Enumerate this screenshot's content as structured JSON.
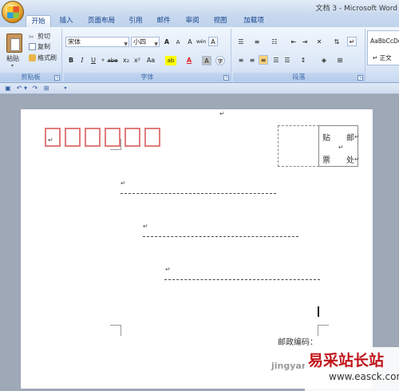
{
  "window": {
    "title": "文档 3 - Microsoft Word"
  },
  "tabs": [
    "开始",
    "插入",
    "页面布局",
    "引用",
    "邮件",
    "审阅",
    "视图",
    "加载项"
  ],
  "clipboard": {
    "paste": "粘贴",
    "cut": "剪切",
    "copy": "复制",
    "format_painter": "格式刷",
    "label": "剪贴板"
  },
  "font": {
    "name": "宋体",
    "size": "小四",
    "label": "字体",
    "buttons": {
      "grow": "A",
      "shrink": "A",
      "clear": "A",
      "phonetic": "wén",
      "border": "A",
      "bold": "B",
      "italic": "I",
      "underline": "U",
      "strike": "abe",
      "subscript": "x₂",
      "superscript": "x²",
      "case": "Aa",
      "highlight": "ab",
      "color": "A",
      "shade": "A",
      "circle": "字"
    }
  },
  "paragraph": {
    "label": "段落"
  },
  "styles": {
    "preview": "AaBbCcDd",
    "normal": "↵ 正文"
  },
  "colors": {
    "accent": "#15428b",
    "zip_box": "#e07b7b",
    "highlight": "#ffff00",
    "font_color": "#e02020",
    "brand_watermark": "#c0151b"
  },
  "document": {
    "paragraph_mark": "↵",
    "stamp": {
      "chars": [
        "贴",
        "邮",
        "票",
        "处"
      ]
    },
    "postal_code_label": "邮政编码："
  },
  "watermark": {
    "site_cn": "易采站长站",
    "site_url": "www.easck.com",
    "bottom": "jingyan.baidu.com"
  }
}
